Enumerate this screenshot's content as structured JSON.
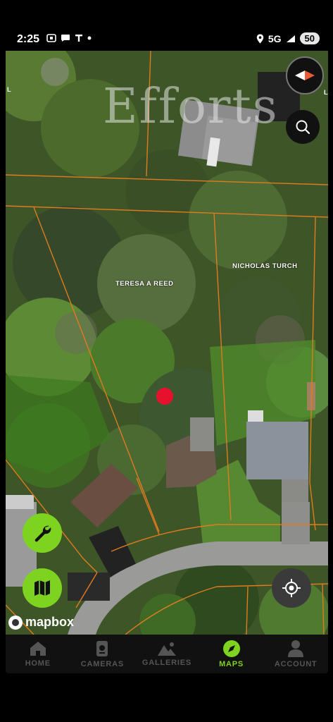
{
  "status_bar": {
    "time": "2:25",
    "network": "5G",
    "battery": "50"
  },
  "map": {
    "watermark": "Efforts",
    "parcel_labels": [
      "TERESA A REED",
      "NICHOLAS TURCH"
    ],
    "edge_letters": [
      "L",
      "L"
    ],
    "marker_color": "#e8112d",
    "parcel_line_color": "#e07b1f",
    "attribution": "mapbox"
  },
  "buttons": {
    "compass_icon": "compass-icon",
    "search_icon": "search-icon",
    "tool_icon": "wrench-icon",
    "layers_icon": "map-layers-icon",
    "locate_icon": "locate-icon",
    "accent": "#7ed321"
  },
  "tabbar": {
    "tabs": [
      {
        "label": "HOME",
        "icon": "home-icon",
        "active": false
      },
      {
        "label": "CAMERAS",
        "icon": "camera-icon",
        "active": false
      },
      {
        "label": "GALLERIES",
        "icon": "galleries-icon",
        "active": false
      },
      {
        "label": "MAPS",
        "icon": "compass-map-icon",
        "active": true
      },
      {
        "label": "ACCOUNT",
        "icon": "account-icon",
        "active": false
      }
    ]
  }
}
